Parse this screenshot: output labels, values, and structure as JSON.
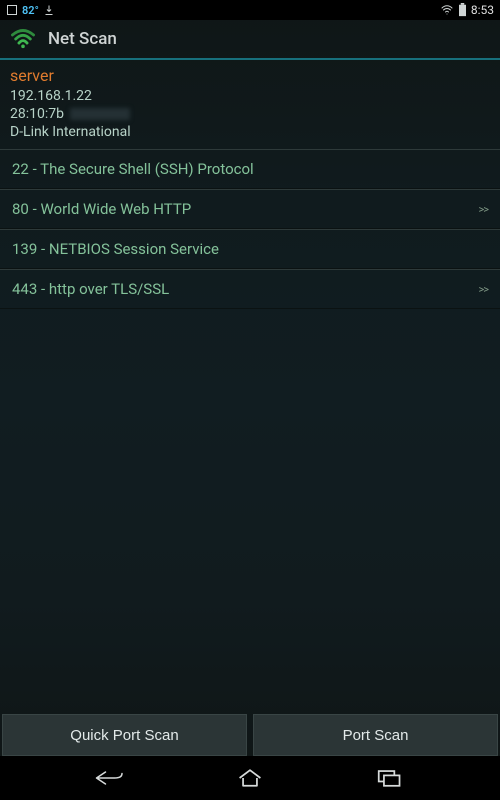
{
  "statusbar": {
    "temperature": "82°",
    "clock": "8:53"
  },
  "app": {
    "title": "Net Scan"
  },
  "server": {
    "name": "server",
    "ip": "192.168.1.22",
    "mac_prefix": "28:10:7b",
    "vendor": "D-Link International"
  },
  "ports": [
    {
      "label": "22 - The Secure Shell (SSH) Protocol",
      "linkable": false
    },
    {
      "label": "80 - World Wide Web HTTP",
      "linkable": true
    },
    {
      "label": "139 - NETBIOS Session Service",
      "linkable": false
    },
    {
      "label": "443 - http over TLS/SSL",
      "linkable": true
    }
  ],
  "buttons": {
    "quick": "Quick Port Scan",
    "scan": "Port Scan"
  }
}
